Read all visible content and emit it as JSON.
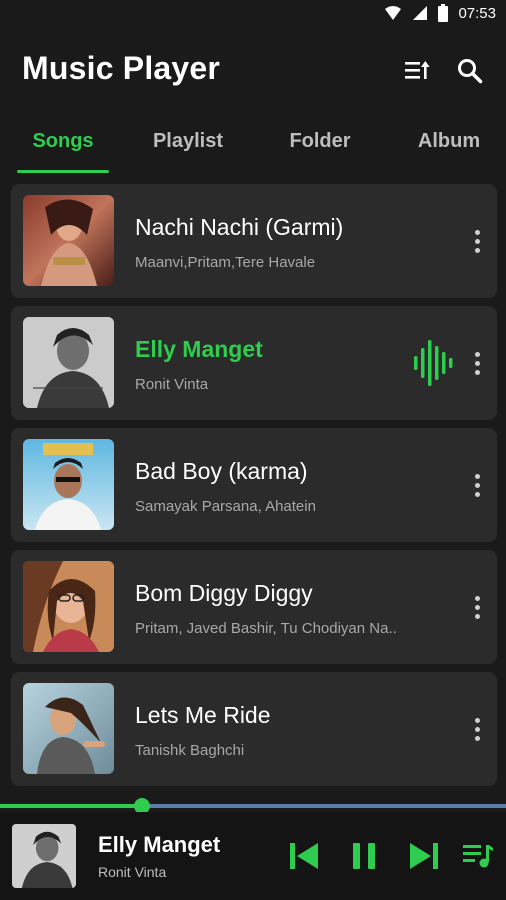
{
  "status_bar": {
    "time": "07:53",
    "icons": [
      "wifi-icon",
      "signal-icon",
      "battery-icon"
    ]
  },
  "app_bar": {
    "title": "Music Player",
    "actions": [
      "sort-icon",
      "search-icon"
    ]
  },
  "tabs": [
    {
      "label": "Songs",
      "active": true
    },
    {
      "label": "Playlist",
      "active": false
    },
    {
      "label": "Folder",
      "active": false
    },
    {
      "label": "Album",
      "active": false
    }
  ],
  "songs": [
    {
      "title": "Nachi Nachi (Garmi)",
      "artist": "Maanvi,Pritam,Tere Havale",
      "playing": false
    },
    {
      "title": "Elly Manget",
      "artist": "Ronit Vinta",
      "playing": true
    },
    {
      "title": "Bad Boy (karma)",
      "artist": "Samayak Parsana, Ahatein",
      "playing": false
    },
    {
      "title": "Bom Diggy Diggy",
      "artist": "Pritam, Javed Bashir, Tu Chodiyan Na..",
      "playing": false
    },
    {
      "title": "Lets Me Ride",
      "artist": "Tanishk Baghchi",
      "playing": false
    }
  ],
  "now_playing": {
    "title": "Elly Manget",
    "artist": "Ronit Vinta",
    "progress": 0.28,
    "controls": [
      "previous-icon",
      "pause-icon",
      "next-icon",
      "queue-icon"
    ]
  },
  "colors": {
    "accent": "#2ecc4f",
    "background": "#1a1a1a",
    "card": "#2b2b2b",
    "progress_track": "#5b7fa8"
  }
}
